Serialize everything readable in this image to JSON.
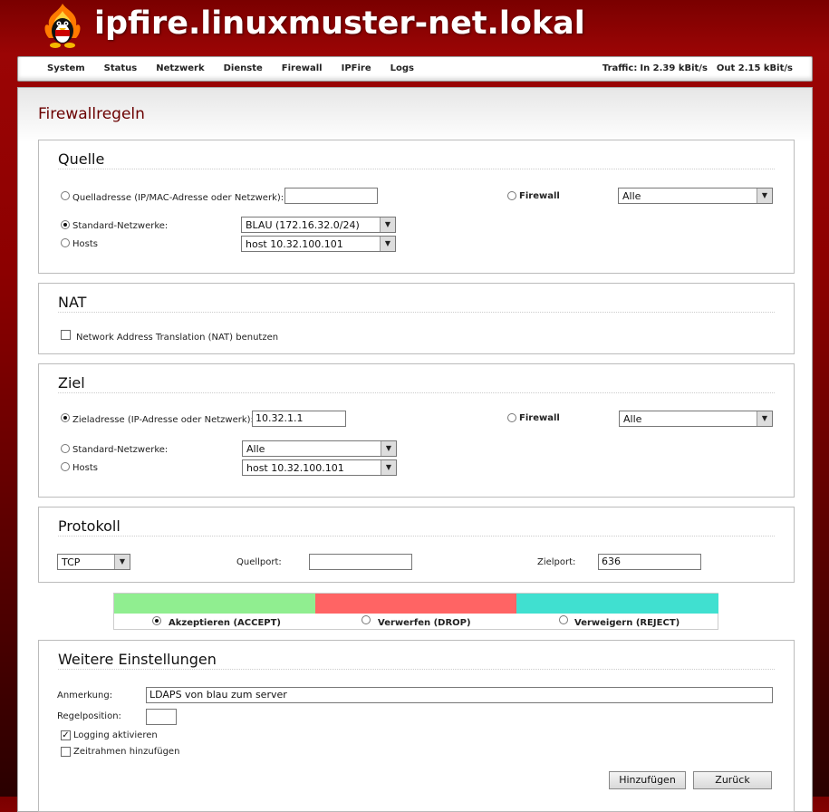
{
  "header": {
    "title": "ipfire.linuxmuster-net.lokal"
  },
  "nav": {
    "items": [
      "System",
      "Status",
      "Netzwerk",
      "Dienste",
      "Firewall",
      "IPFire",
      "Logs"
    ],
    "traffic_label": "Traffic:",
    "traffic_in": "In 2.39 kBit/s",
    "traffic_out": "Out 2.15 kBit/s"
  },
  "page": {
    "title": "Firewallregeln"
  },
  "quelle": {
    "title": "Quelle",
    "addr_label": "Quelladresse (IP/MAC-Adresse oder Netzwerk):",
    "addr_value": "",
    "firewall_label": "Firewall",
    "firewall_select": "Alle",
    "std_label": "Standard-Netzwerke:",
    "std_select": "BLAU (172.16.32.0/24)",
    "hosts_label": "Hosts",
    "hosts_select": "host 10.32.100.101"
  },
  "nat": {
    "title": "NAT",
    "checkbox_label": "Network Address Translation (NAT) benutzen"
  },
  "ziel": {
    "title": "Ziel",
    "addr_label": "Zieladresse (IP-Adresse oder Netzwerk):",
    "addr_value": "10.32.1.1",
    "firewall_label": "Firewall",
    "firewall_select": "Alle",
    "std_label": "Standard-Netzwerke:",
    "std_select": "Alle",
    "hosts_label": "Hosts",
    "hosts_select": "host 10.32.100.101"
  },
  "protokoll": {
    "title": "Protokoll",
    "protocol": "TCP",
    "quellport_label": "Quellport:",
    "quellport_value": "",
    "zielport_label": "Zielport:",
    "zielport_value": "636"
  },
  "actions": {
    "accept": "Akzeptieren (ACCEPT)",
    "drop": "Verwerfen (DROP)",
    "reject": "Verweigern (REJECT)",
    "colors": {
      "accept": "#90ee90",
      "drop": "#ff6464",
      "reject": "#40e0d0"
    }
  },
  "weitere": {
    "title": "Weitere Einstellungen",
    "anmerkung_label": "Anmerkung:",
    "anmerkung_value": "LDAPS von blau zum server",
    "regelposition_label": "Regelposition:",
    "regelposition_value": "",
    "logging_label": "Logging aktivieren",
    "zeitrahmen_label": "Zeitrahmen hinzufügen",
    "add_button": "Hinzufügen",
    "back_button": "Zurück"
  }
}
